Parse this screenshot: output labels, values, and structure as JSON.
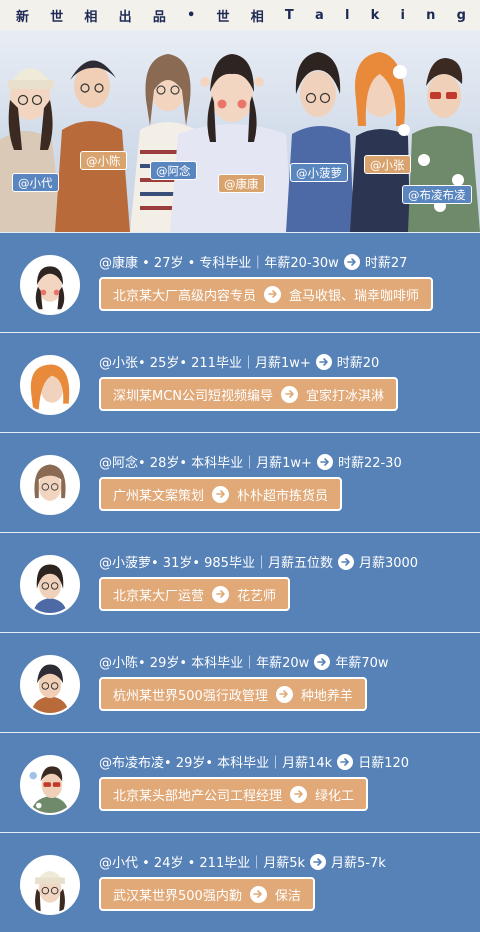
{
  "header": {
    "chars": [
      "新",
      "世",
      "相",
      "出",
      "品",
      "•",
      "世",
      "相",
      "T",
      "a",
      "l",
      "k",
      "i",
      "n",
      "g"
    ]
  },
  "banner": {
    "tags": [
      {
        "label": "@小代",
        "style": "blue"
      },
      {
        "label": "@小陈",
        "style": "tan"
      },
      {
        "label": "@阿念",
        "style": "blue"
      },
      {
        "label": "@康康",
        "style": "tan"
      },
      {
        "label": "@小菠萝",
        "style": "blue"
      },
      {
        "label": "@小张",
        "style": "tan"
      },
      {
        "label": "@布凌布凌",
        "style": "blue"
      }
    ]
  },
  "colors": {
    "background": "#5782b8",
    "pill": "#e2a978",
    "header_text": "#1e2a55"
  },
  "profiles": [
    {
      "avatar": "kangkang-avatar",
      "info": "@康康 • 27岁 • 专科毕业｜年薪20-30w",
      "now_pay": "时薪27",
      "before_job": "北京某大厂高级内容专员",
      "now_job": "盒马收银、瑞幸咖啡师"
    },
    {
      "avatar": "xiaozhang-avatar",
      "info": "@小张• 25岁• 211毕业｜月薪1w+",
      "now_pay": "时薪20",
      "before_job": "深圳某MCN公司短视频编导",
      "now_job": "宜家打冰淇淋"
    },
    {
      "avatar": "anian-avatar",
      "info": "@阿念• 28岁• 本科毕业｜月薪1w+",
      "now_pay": "时薪22-30",
      "before_job": "广州某文案策划",
      "now_job": "朴朴超市拣货员"
    },
    {
      "avatar": "xiaoboluo-avatar",
      "info": "@小菠萝• 31岁• 985毕业｜月薪五位数",
      "now_pay": "月薪3000",
      "before_job": "北京某大厂运营",
      "now_job": "花艺师"
    },
    {
      "avatar": "xiaochen-avatar",
      "info": "@小陈• 29岁• 本科毕业｜年薪20w",
      "now_pay": "年薪70w",
      "before_job": "杭州某世界500强行政管理",
      "now_job": "种地养羊"
    },
    {
      "avatar": "bulingbuling-avatar",
      "info": "@布凌布凌• 29岁• 本科毕业｜月薪14k",
      "now_pay": "日薪120",
      "before_job": "北京某头部地产公司工程经理",
      "now_job": "绿化工"
    },
    {
      "avatar": "xiaodai-avatar",
      "info": "@小代 • 24岁 • 211毕业｜月薪5k",
      "now_pay": "月薪5-7k",
      "before_job": "武汉某世界500强内勤",
      "now_job": "保洁"
    }
  ]
}
